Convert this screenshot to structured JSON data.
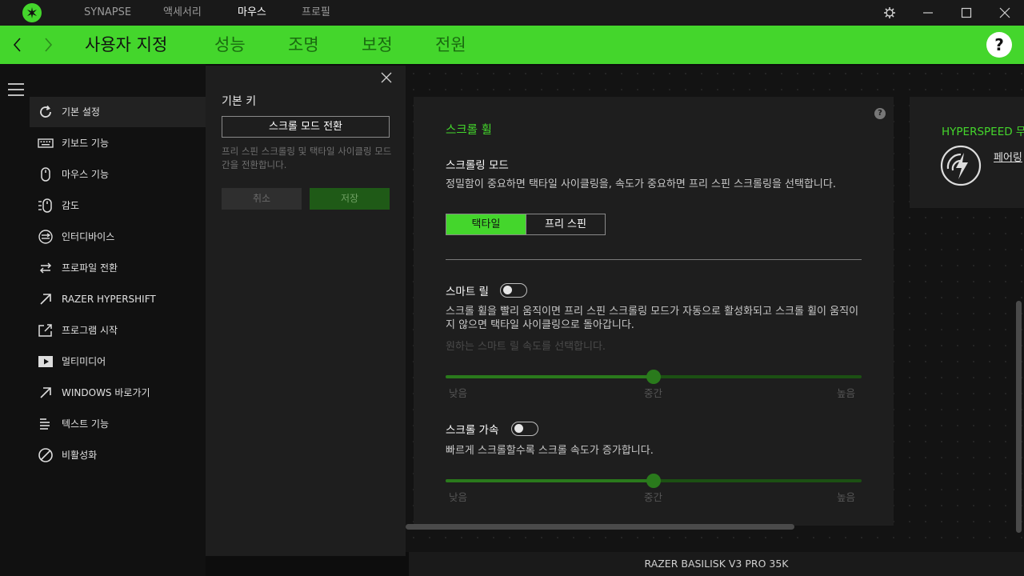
{
  "titlebar": {
    "tabs": [
      {
        "label": "SYNAPSE",
        "active": false
      },
      {
        "label": "액세서리",
        "active": false
      },
      {
        "label": "마우스",
        "active": true
      },
      {
        "label": "프로필",
        "active": false
      }
    ],
    "icons": [
      "razer-logo-icon",
      "settings-icon",
      "minimize-icon",
      "maximize-icon",
      "close-icon"
    ]
  },
  "header": {
    "tabs": [
      {
        "label": "사용자 지정",
        "active": true
      },
      {
        "label": "성능",
        "active": false
      },
      {
        "label": "조명",
        "active": false
      },
      {
        "label": "보정",
        "active": false
      },
      {
        "label": "전원",
        "active": false
      }
    ],
    "help_label": "?"
  },
  "sidebar": {
    "items": [
      {
        "label": "기본 설정",
        "icon": "reset-icon",
        "active": true
      },
      {
        "label": "키보드 기능",
        "icon": "keyboard-icon",
        "active": false
      },
      {
        "label": "마우스 기능",
        "icon": "mouse-icon",
        "active": false
      },
      {
        "label": "감도",
        "icon": "sensitivity-icon",
        "active": false
      },
      {
        "label": "인터디바이스",
        "icon": "interdevice-icon",
        "active": false
      },
      {
        "label": "프로파일 전환",
        "icon": "profile-switch-icon",
        "active": false
      },
      {
        "label": "RAZER HYPERSHIFT",
        "icon": "hypershift-arrow-icon",
        "active": false
      },
      {
        "label": "프로그램 시작",
        "icon": "launch-program-icon",
        "active": false
      },
      {
        "label": "멀티미디어",
        "icon": "play-icon",
        "active": false
      },
      {
        "label": "WINDOWS 바로가기",
        "icon": "shortcut-arrow-icon",
        "active": false
      },
      {
        "label": "텍스트 기능",
        "icon": "text-icon",
        "active": false
      },
      {
        "label": "비활성화",
        "icon": "disable-icon",
        "active": false
      }
    ]
  },
  "panel": {
    "title": "기본 키",
    "selected": "스크롤 모드 전환",
    "description": "프리 스핀 스크롤링 및 택타일 사이클링 모드 간을 전환합니다.",
    "cancel_label": "취소",
    "save_label": "저장"
  },
  "scroll_card": {
    "title": "스크롤 휠",
    "help_label": "?",
    "mode": {
      "title": "스크롤링 모드",
      "description": "정밀함이 중요하면 택타일 사이클링을, 속도가 중요하면 프리 스핀 스크롤링을 선택합니다.",
      "options": [
        "택타일",
        "프리 스핀"
      ],
      "selected": "택타일"
    },
    "smart_reel": {
      "title": "스마트 릴",
      "enabled": false,
      "description": "스크롤 휠을 빨리 움직이면 프리 스핀 스크롤링 모드가 자동으로 활성화되고 스크롤 휠이 움직이지 않으면 택타일 사이클링으로 돌아갑니다.",
      "speed_hint": "원하는 스마트 릴 속도를 선택합니다.",
      "slider": {
        "value": 0.5,
        "low": "낮음",
        "mid": "중간",
        "high": "높음"
      }
    },
    "acceleration": {
      "title": "스크롤 가속",
      "enabled": false,
      "description": "빠르게 스크롤할수록 스크롤 속도가 증가합니다.",
      "slider": {
        "value": 0.5,
        "low": "낮음",
        "mid": "중간",
        "high": "높음"
      }
    }
  },
  "hyperspeed_card": {
    "title": "HYPERSPEED 무",
    "link": "페어링"
  },
  "device": {
    "name": "RAZER BASILISK V3 PRO 35K"
  },
  "colors": {
    "accent": "#44d62c",
    "background": "#0d0d0d",
    "card": "#1e1e1e"
  }
}
